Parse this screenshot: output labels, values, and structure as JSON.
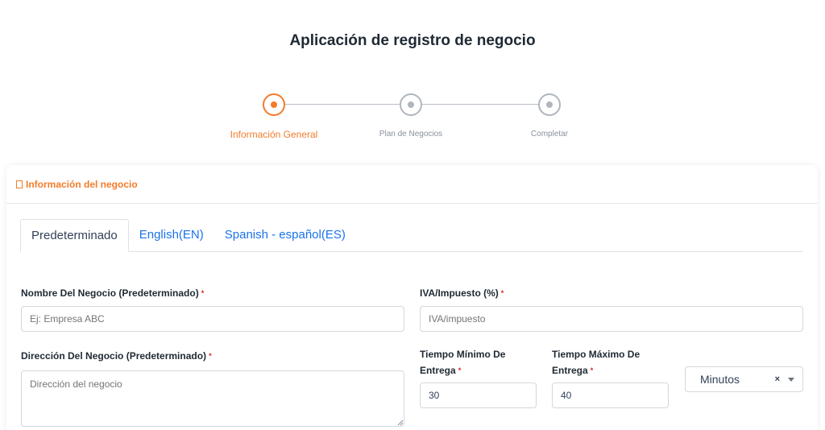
{
  "page": {
    "title": "Aplicación de registro de negocio"
  },
  "stepper": {
    "steps": [
      {
        "label": "Información General",
        "active": true
      },
      {
        "label": "Plan de Negocios",
        "active": false
      },
      {
        "label": "Completar",
        "active": false
      }
    ]
  },
  "card": {
    "header_icon": "document-icon",
    "header_title": "Información del negocio"
  },
  "tabs": [
    {
      "label": "Predeterminado",
      "active": true
    },
    {
      "label": "English(EN)",
      "active": false
    },
    {
      "label": "Spanish - español(ES)",
      "active": false
    }
  ],
  "form": {
    "business_name": {
      "label": "Nombre Del Negocio (Predeterminado)",
      "required": "*",
      "placeholder": "Ej: Empresa ABC",
      "value": ""
    },
    "tax": {
      "label": "IVA/Impuesto (%)",
      "required": "*",
      "placeholder": "IVA/impuesto",
      "value": ""
    },
    "address": {
      "label": "Dirección Del Negocio (Predeterminado)",
      "required": "*",
      "placeholder": "Dirección del negocio",
      "value": ""
    },
    "min_delivery": {
      "label_line1": "Tiempo Mínimo De",
      "label_line2": "Entrega",
      "required": "*",
      "value": "30"
    },
    "max_delivery": {
      "label_line1": "Tiempo Máximo De",
      "label_line2": "Entrega",
      "required": "*",
      "value": "40"
    },
    "time_unit": {
      "selected": "Minutos",
      "clear_glyph": "×"
    }
  },
  "colors": {
    "accent": "#f27c2c",
    "link": "#1a73e8",
    "required": "#e02424"
  }
}
